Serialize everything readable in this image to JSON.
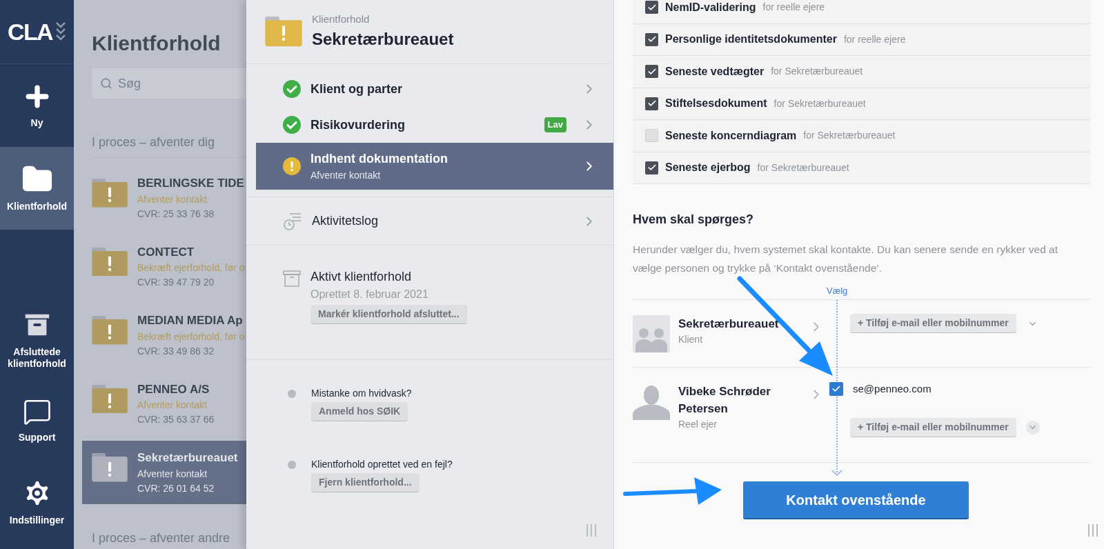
{
  "sidebar": {
    "logo": "CLA",
    "items": [
      {
        "kind": "new",
        "label": "Ny",
        "selected": false
      },
      {
        "kind": "clients",
        "label": "Klientforhold",
        "selected": true
      },
      {
        "kind": "archive",
        "label": "Afsluttede klientforhold",
        "selected": false
      },
      {
        "kind": "support",
        "label": "Support",
        "selected": false
      },
      {
        "kind": "settings",
        "label": "Indstillinger",
        "selected": false
      }
    ]
  },
  "client_list": {
    "title": "Klientforhold",
    "search": {
      "placeholder": "Søg"
    },
    "sections": [
      {
        "heading": "I proces – afventer dig",
        "items": [
          {
            "name": "BERLINGSKE TIDE",
            "status": "Afventer kontakt",
            "cvr": "CVR: 25 33 76 38",
            "selected": false
          },
          {
            "name": "CONTECT",
            "status": "Bekræft ejerforhold, før o",
            "cvr": "CVR: 39 47 79 20",
            "selected": false
          },
          {
            "name": "MEDIAN MEDIA Ap",
            "status": "Bekræft ejerforhold, før o",
            "cvr": "CVR: 33 49 86 32",
            "selected": false
          },
          {
            "name": "PENNEO A/S",
            "status": "Afventer kontakt",
            "cvr": "CVR: 35 63 37 66",
            "selected": false
          },
          {
            "name": "Sekretærbureauet",
            "status": "Afventer kontakt",
            "cvr": "CVR: 26 01 64 52",
            "selected": true
          }
        ]
      },
      {
        "heading": "I proces – afventer andre"
      }
    ]
  },
  "detail": {
    "caption": "Klientforhold",
    "title": "Sekretærbureauet",
    "steps": [
      {
        "label": "Klient og parter",
        "kind": "done",
        "selected": false
      },
      {
        "label": "Risikovurdering",
        "kind": "done",
        "badge": "Lav",
        "selected": false
      },
      {
        "label": "Indhent dokumentation",
        "sub": "Afventer kontakt",
        "kind": "warning",
        "selected": true
      }
    ],
    "activity": {
      "label": "Aktivitetslog"
    },
    "active": {
      "title": "Aktivt klientforhold",
      "date": "Oprettet 8. februar 2021",
      "button": "Markér klientforhold afsluttet..."
    },
    "actions": [
      {
        "question": "Mistanke om hvidvask?",
        "button": "Anmeld hos SØIK"
      },
      {
        "question": "Klientforhold oprettet ved en fejl?",
        "button": "Fjern klientforhold..."
      }
    ]
  },
  "documents": [
    {
      "label": "NemID-validering",
      "note": "for reelle ejere",
      "checked": true
    },
    {
      "label": "Personlige identitetsdokumenter",
      "note": "for reelle ejere",
      "checked": true
    },
    {
      "label": "Seneste vedtægter",
      "note": "for Sekretærbureauet",
      "checked": true
    },
    {
      "label": "Stiftelsesdokument",
      "note": "for Sekretærbureauet",
      "checked": true
    },
    {
      "label": "Seneste koncerndiagram",
      "note": "for Sekretærbureauet",
      "checked": false
    },
    {
      "label": "Seneste ejerbog",
      "note": "for Sekretærbureauet",
      "checked": true
    }
  ],
  "contacts": {
    "heading": "Hvem skal spørges?",
    "description": "Herunder vælger du, hvem systemet skal kontakte. Du kan senere sende en rykker ved at vælge personen og trykke på ‘Kontakt ovenstående’.",
    "choose_label": "Vælg",
    "people": [
      {
        "kind": "company",
        "name": "Sekretærbureauet",
        "role": "Klient",
        "add_button": "+ Tilføj e-mail eller mobilnummer"
      },
      {
        "kind": "person",
        "name": "Vibeke Schrøder Petersen",
        "role": "Reel ejer",
        "email": "se@penneo.com",
        "email_checked": true,
        "add_button": "+ Tilføj e-mail eller mobilnummer"
      }
    ],
    "submit": "Kontakt ovenstående"
  }
}
